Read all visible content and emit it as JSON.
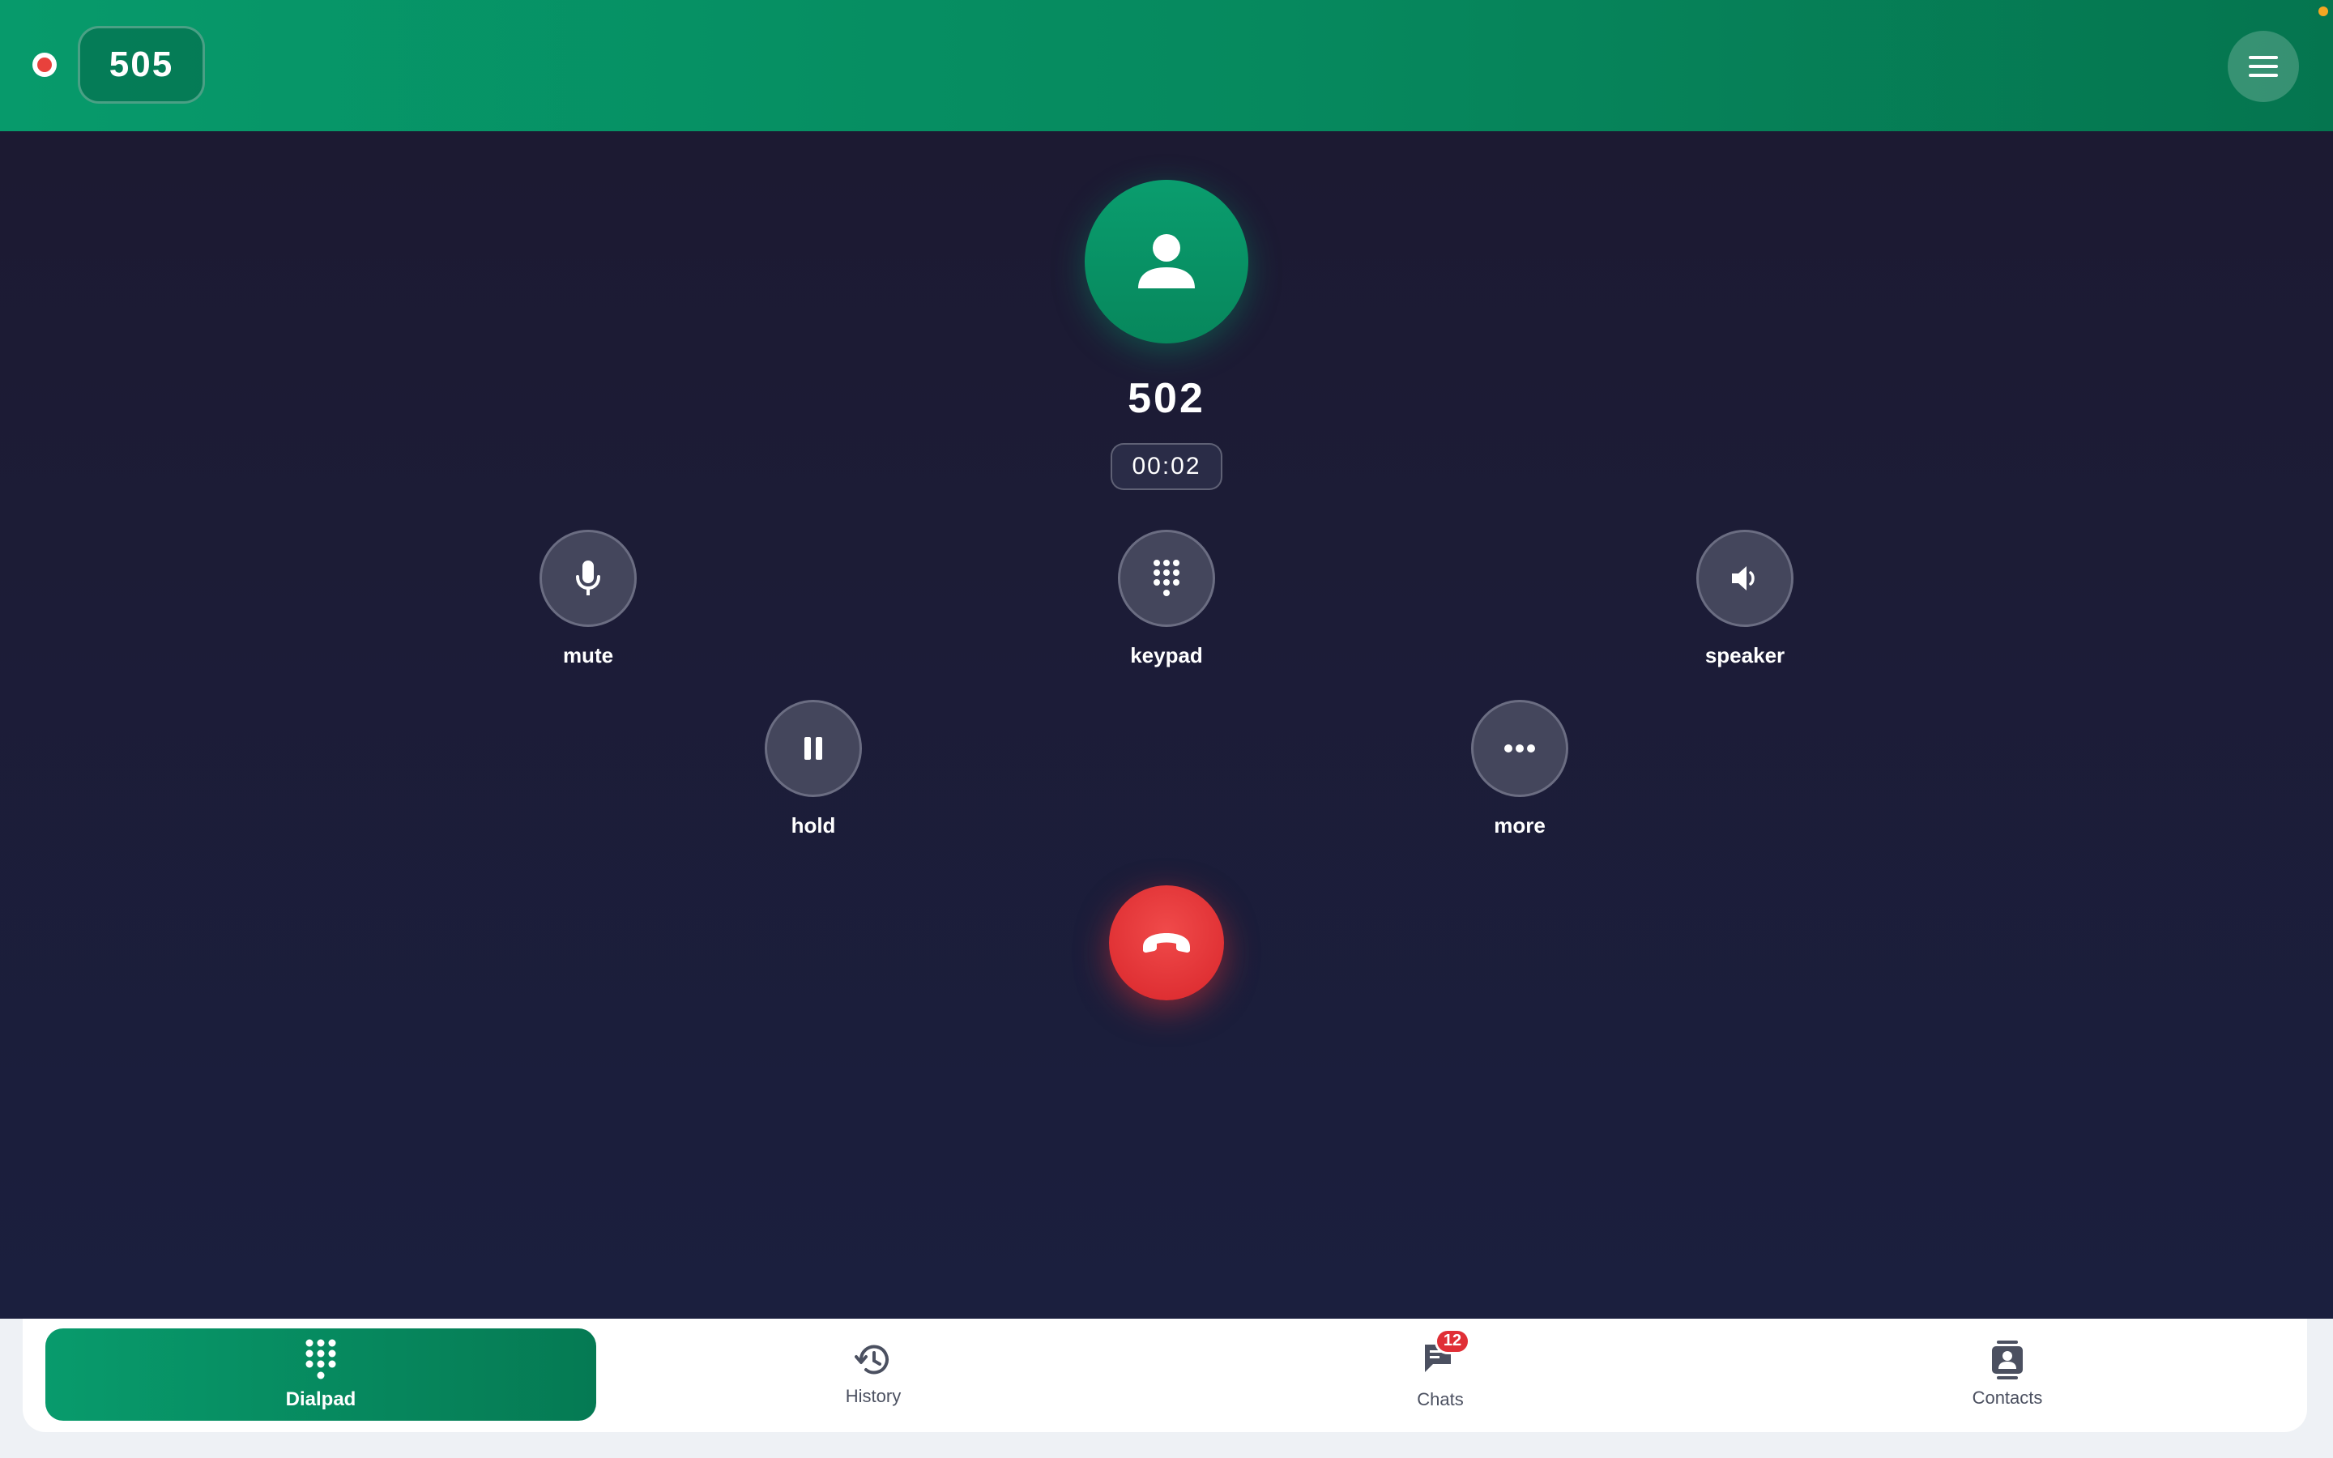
{
  "header": {
    "extension": "505",
    "status_color": "#e8413c",
    "menu_icon": "hamburger-menu-icon"
  },
  "call": {
    "caller_number": "502",
    "duration": "00:02",
    "avatar_icon": "person-icon"
  },
  "controls": {
    "mute": {
      "label": "mute",
      "icon": "microphone-icon"
    },
    "keypad": {
      "label": "keypad",
      "icon": "keypad-icon"
    },
    "speaker": {
      "label": "speaker",
      "icon": "speaker-icon"
    },
    "hold": {
      "label": "hold",
      "icon": "pause-icon"
    },
    "more": {
      "label": "more",
      "icon": "more-dots-icon"
    },
    "hangup": {
      "icon": "hangup-phone-icon",
      "color": "#e53935"
    }
  },
  "nav": {
    "dialpad": {
      "label": "Dialpad",
      "icon": "dialpad-icon",
      "active": true
    },
    "history": {
      "label": "History",
      "icon": "history-icon"
    },
    "chats": {
      "label": "Chats",
      "icon": "chat-icon",
      "badge": "12"
    },
    "contacts": {
      "label": "Contacts",
      "icon": "contacts-icon"
    }
  },
  "colors": {
    "brand_green": "#07875c",
    "background": "#1b1c34",
    "danger": "#e02f36"
  }
}
